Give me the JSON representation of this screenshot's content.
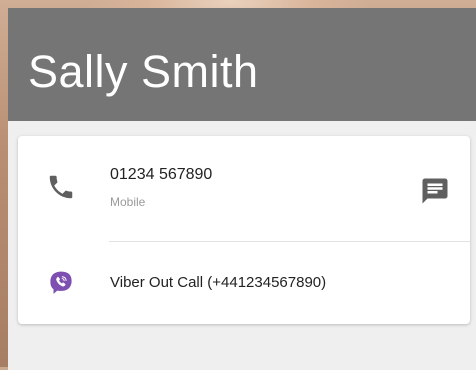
{
  "contact": {
    "name": "Sally Smith"
  },
  "phone_entry": {
    "number": "01234 567890",
    "type": "Mobile"
  },
  "viber_entry": {
    "label": "Viber Out Call (+441234567890)"
  },
  "colors": {
    "appbar": "#757575",
    "viber_purple": "#7d4fb0",
    "icon_gray": "#5f5f5f"
  },
  "icons": {
    "call": "phone-icon",
    "sms": "message-icon",
    "viber": "viber-icon"
  }
}
